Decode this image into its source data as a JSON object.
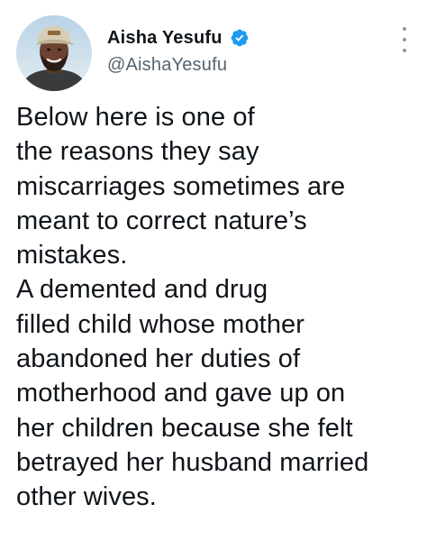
{
  "tweet": {
    "author": {
      "display_name": "Aisha Yesufu",
      "handle": "@AishaYesufu",
      "verified": true,
      "verified_icon": "verified-badge-icon",
      "avatar_icon": "profile-photo"
    },
    "menu_icon": "more-options-icon",
    "text_lines": [
      "Below here is one of",
      "the reasons they say",
      "miscarriages sometimes are",
      "meant to correct nature’s",
      "mistakes.",
      "A demented and drug",
      "filled child whose mother",
      "abandoned her duties of",
      "motherhood and gave up on",
      "her children because she felt",
      "betrayed her husband married",
      "other wives."
    ]
  },
  "colors": {
    "text_primary": "#0f1419",
    "text_secondary": "#536471",
    "verified_blue": "#1d9bf0"
  }
}
